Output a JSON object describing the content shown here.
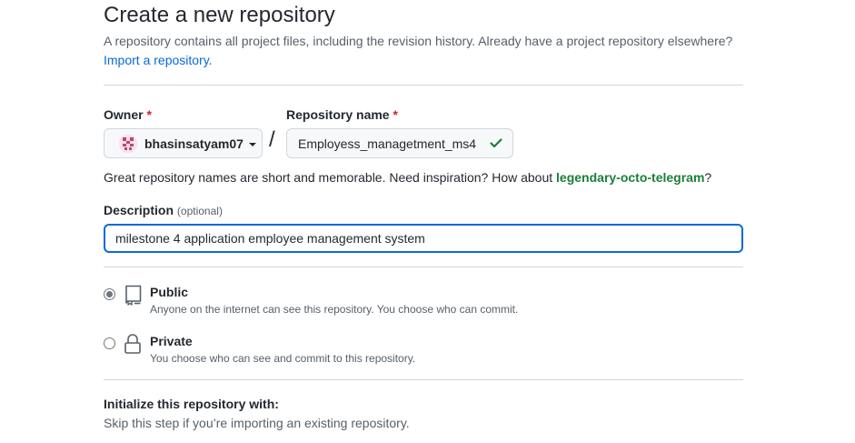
{
  "header": {
    "title": "Create a new repository",
    "subtitle": "A repository contains all project files, including the revision history. Already have a project repository elsewhere?",
    "import_link": "Import a repository."
  },
  "owner": {
    "label": "Owner",
    "required_mark": "*",
    "value": "bhasinsatyam07",
    "avatar_icon": "identicon-avatar",
    "dropdown_icon": "caret-down-icon"
  },
  "separator": "/",
  "repository_name": {
    "label": "Repository name",
    "required_mark": "*",
    "value": "Employess_managetment_ms4",
    "status_icon": "check-icon",
    "status_color": "#1a7f37"
  },
  "name_hint": {
    "prefix": "Great repository names are short and memorable. Need inspiration? How about ",
    "suggestion": "legendary-octo-telegram",
    "suffix": "?"
  },
  "description": {
    "label": "Description",
    "optional": "(optional)",
    "value": "milestone 4 application employee management system"
  },
  "visibility": {
    "selected": "public",
    "options": [
      {
        "id": "public",
        "label": "Public",
        "description": "Anyone on the internet can see this repository. You choose who can commit.",
        "icon": "repo-icon"
      },
      {
        "id": "private",
        "label": "Private",
        "description": "You choose who can see and commit to this repository.",
        "icon": "lock-icon"
      }
    ]
  },
  "initialize": {
    "title": "Initialize this repository with:",
    "description": "Skip this step if you’re importing an existing repository."
  },
  "colors": {
    "link": "#0969da",
    "required": "#cf222e",
    "suggestion": "#1a7f37",
    "focus_border": "#0969da"
  }
}
